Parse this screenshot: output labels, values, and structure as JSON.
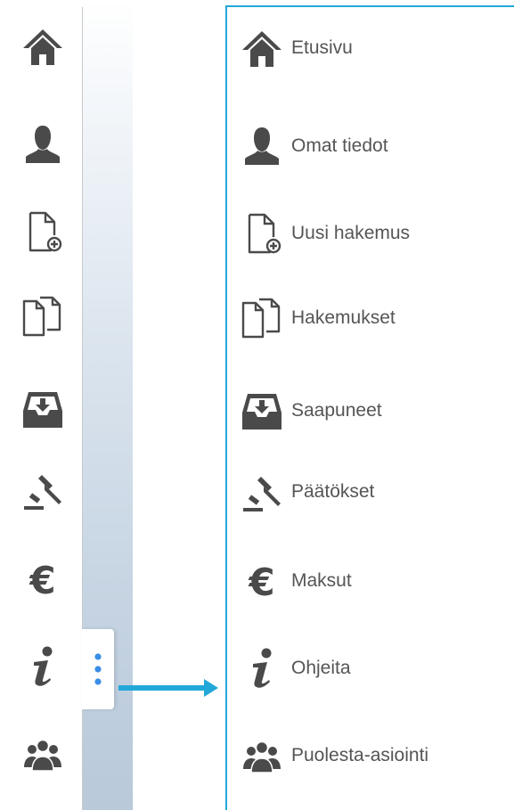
{
  "expanded_menu": {
    "items": [
      {
        "label": "Etusivu"
      },
      {
        "label": "Omat tiedot"
      },
      {
        "label": "Uusi hakemus"
      },
      {
        "label": "Hakemukset"
      },
      {
        "label": "Saapuneet"
      },
      {
        "label": "Päätökset"
      },
      {
        "label": "Maksut"
      },
      {
        "label": "Ohjeita"
      },
      {
        "label": "Puolesta-asiointi"
      }
    ]
  },
  "icons": [
    "home-icon",
    "user-icon",
    "new-document-icon",
    "documents-icon",
    "inbox-icon",
    "gavel-icon",
    "euro-icon",
    "info-icon",
    "group-icon"
  ],
  "colors": {
    "icon": "#4a4a4a",
    "accent": "#22a8d8",
    "dots": "#3a8ee6",
    "label": "#555555"
  }
}
